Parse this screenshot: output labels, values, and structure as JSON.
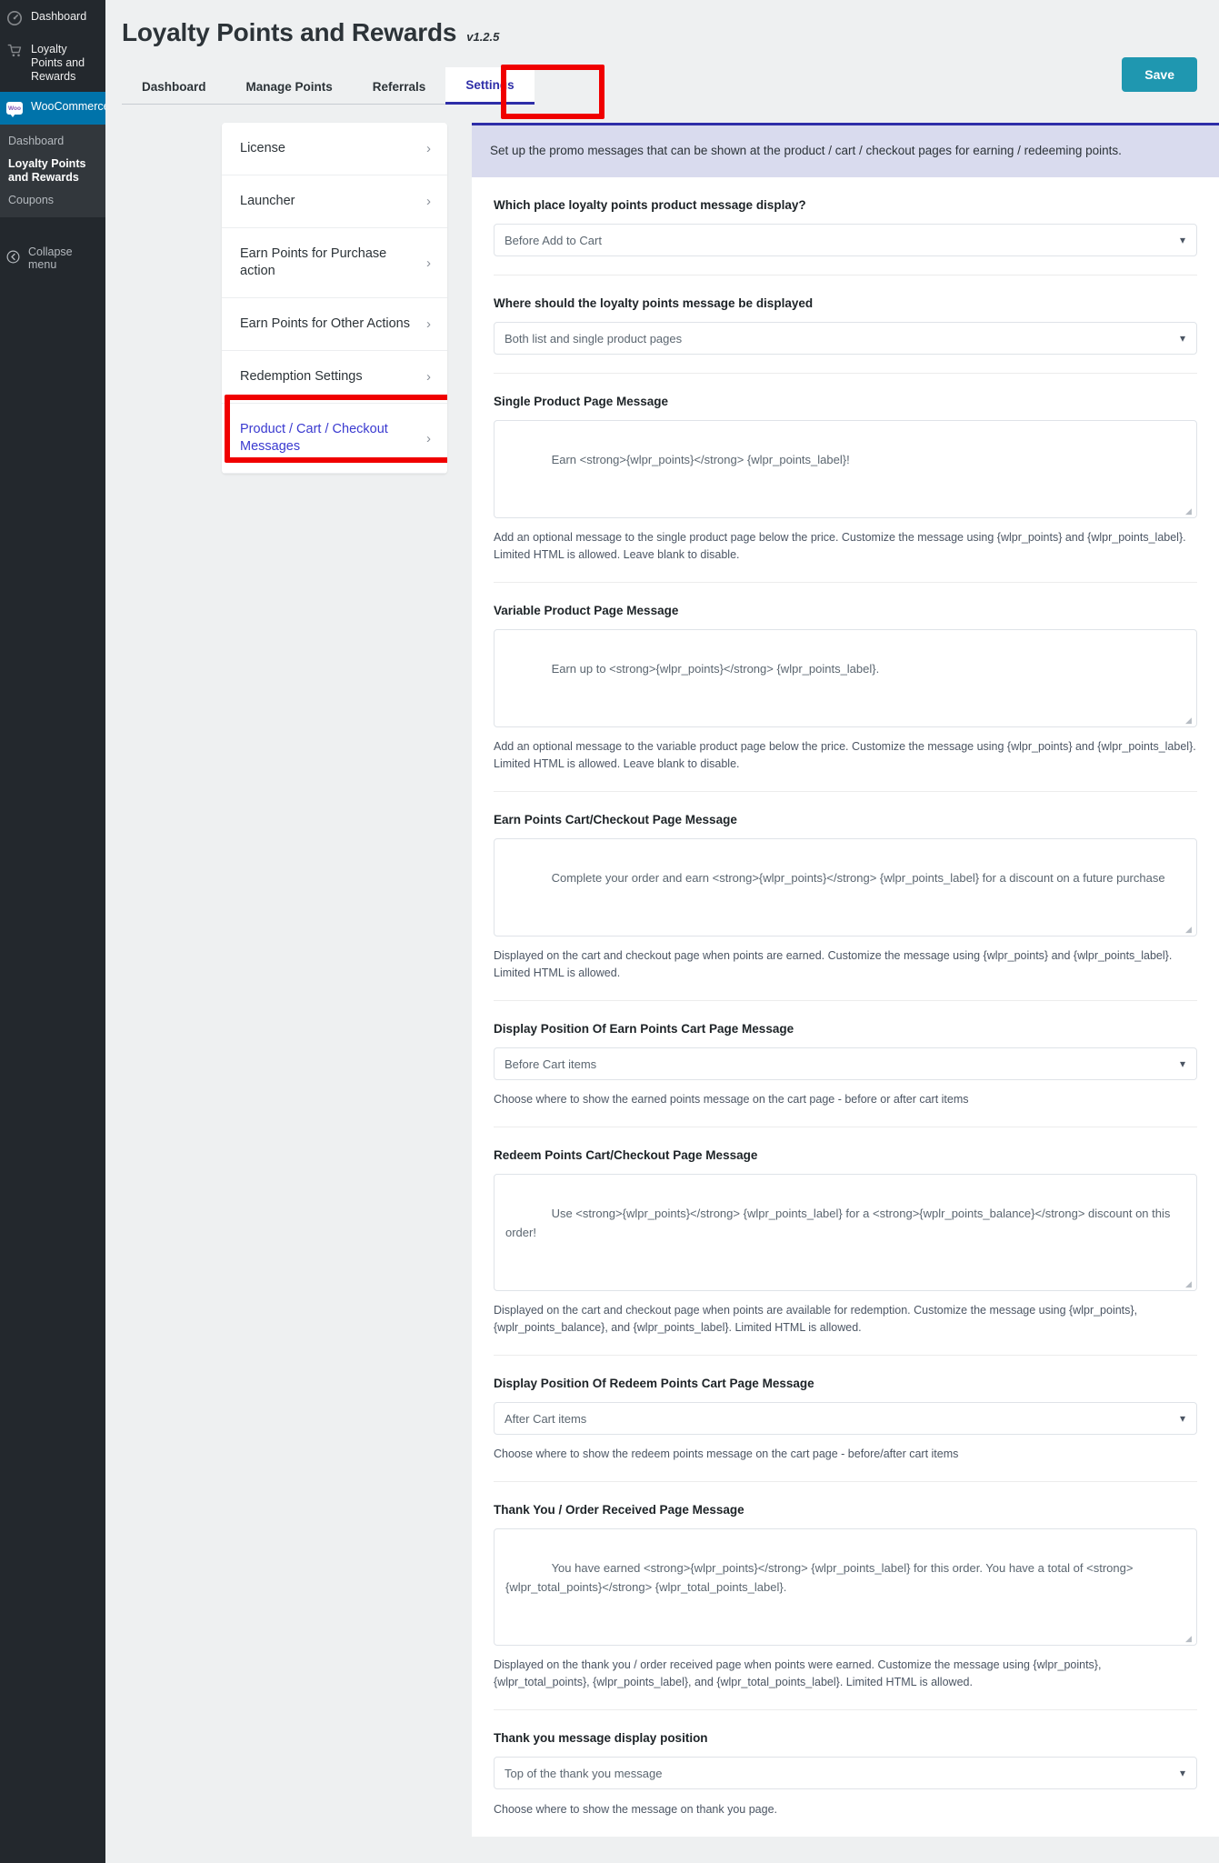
{
  "wp_sidebar": {
    "items": [
      {
        "label": "Dashboard",
        "icon": "dashboard-icon",
        "active": false
      },
      {
        "label": "Loyalty Points and Rewards",
        "icon": "cart-icon",
        "active": false
      },
      {
        "label": "WooCommerce",
        "icon": "woo-icon",
        "active": true
      }
    ],
    "woo_badge": "Woo",
    "submenu": [
      {
        "label": "Dashboard",
        "current": false
      },
      {
        "label": "Loyalty Points and Rewards",
        "current": true
      },
      {
        "label": "Coupons",
        "current": false
      }
    ],
    "collapse_label": "Collapse menu"
  },
  "header": {
    "title": "Loyalty Points and Rewards",
    "version": "v1.2.5"
  },
  "tabs": [
    {
      "label": "Dashboard",
      "active": false
    },
    {
      "label": "Manage Points",
      "active": false
    },
    {
      "label": "Referrals",
      "active": false
    },
    {
      "label": "Settings",
      "active": true
    }
  ],
  "toolbar": {
    "save_label": "Save"
  },
  "settings_menu": {
    "items": [
      {
        "label": "License",
        "active": false
      },
      {
        "label": "Launcher",
        "active": false
      },
      {
        "label": "Earn Points for Purchase action",
        "active": false
      },
      {
        "label": "Earn Points for Other Actions",
        "active": false
      },
      {
        "label": "Redemption Settings",
        "active": false
      },
      {
        "label": "Product / Cart / Checkout Messages",
        "active": true
      }
    ],
    "chevron": "›"
  },
  "info_box": {
    "text": "Set up the promo messages that can be shown at the product / cart / checkout pages for earning / redeeming points."
  },
  "fields": {
    "product_message_place": {
      "label": "Which place loyalty points product message display?",
      "value": "Before Add to Cart"
    },
    "message_display_where": {
      "label": "Where should the loyalty points message be displayed",
      "value": "Both list and single product pages"
    },
    "single_product_message": {
      "label": "Single Product Page Message",
      "value": "Earn <strong>{wlpr_points}</strong> {wlpr_points_label}!",
      "help": "Add an optional message to the single product page below the price. Customize the message using {wlpr_points} and {wlpr_points_label}. Limited HTML is allowed. Leave blank to disable."
    },
    "variable_product_message": {
      "label": "Variable Product Page Message",
      "value": "Earn up to <strong>{wlpr_points}</strong> {wlpr_points_label}.",
      "help": "Add an optional message to the variable product page below the price. Customize the message using {wlpr_points} and {wlpr_points_label}. Limited HTML is allowed. Leave blank to disable."
    },
    "earn_points_cart_message": {
      "label": "Earn Points Cart/Checkout Page Message",
      "value": "Complete your order and earn <strong>{wlpr_points}</strong> {wlpr_points_label} for a discount on a future purchase",
      "help": "Displayed on the cart and checkout page when points are earned. Customize the message using {wlpr_points} and {wlpr_points_label}. Limited HTML is allowed."
    },
    "earn_points_position": {
      "label": "Display Position Of Earn Points Cart Page Message",
      "value": "Before Cart items",
      "help": "Choose where to show the earned points message on the cart page - before or after cart items"
    },
    "redeem_points_cart_message": {
      "label": "Redeem Points Cart/Checkout Page Message",
      "value": "Use <strong>{wlpr_points}</strong> {wlpr_points_label} for a <strong>{wplr_points_balance}</strong> discount on this order!",
      "help": "Displayed on the cart and checkout page when points are available for redemption. Customize the message using {wlpr_points}, {wplr_points_balance}, and {wlpr_points_label}. Limited HTML is allowed."
    },
    "redeem_points_position": {
      "label": "Display Position Of Redeem Points Cart Page Message",
      "value": "After Cart items",
      "help": "Choose where to show the redeem points message on the cart page - before/after cart items"
    },
    "thank_you_message": {
      "label": "Thank You / Order Received Page Message",
      "value": "You have earned <strong>{wlpr_points}</strong> {wlpr_points_label} for this order. You have a total of <strong>{wlpr_total_points}</strong> {wlpr_total_points_label}.",
      "help": "Displayed on the thank you / order received page when points were earned. Customize the message using {wlpr_points}, {wlpr_total_points}, {wlpr_points_label}, and {wlpr_total_points_label}. Limited HTML is allowed."
    },
    "thank_you_position": {
      "label": "Thank you message display position",
      "value": "Top of the thank you message",
      "help": "Choose where to show the message on thank you page."
    }
  },
  "colors": {
    "accent_blue": "#2e2ea8",
    "save_teal": "#1f97b0",
    "wp_blue": "#0073aa",
    "highlight_red": "#f00000"
  }
}
